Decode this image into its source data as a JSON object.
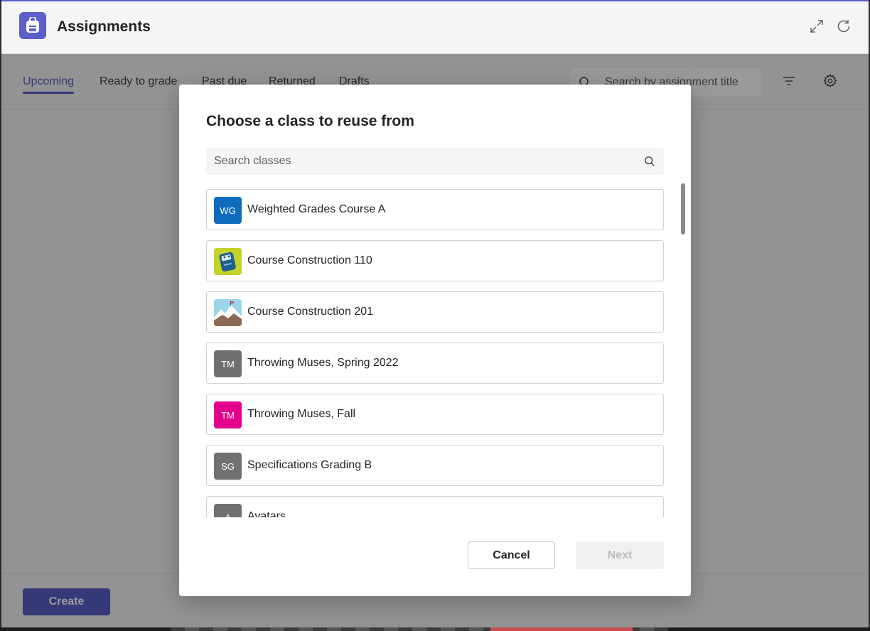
{
  "app": {
    "title": "Assignments"
  },
  "tabs": [
    {
      "label": "Upcoming",
      "active": true
    },
    {
      "label": "Ready to grade",
      "active": false
    },
    {
      "label": "Past due",
      "active": false
    },
    {
      "label": "Returned",
      "active": false
    },
    {
      "label": "Drafts",
      "active": false
    }
  ],
  "search": {
    "placeholder": "Search by assignment title"
  },
  "footer": {
    "create_label": "Create"
  },
  "dialog": {
    "title": "Choose a class to reuse from",
    "search_placeholder": "Search classes",
    "classes": [
      {
        "name": "Weighted Grades Course A",
        "initials": "WG",
        "color": "#0f6cbd",
        "avatar": "initials"
      },
      {
        "name": "Course Construction 110",
        "initials": "",
        "color": "#c4d22a",
        "avatar": "image-robot"
      },
      {
        "name": "Course Construction 201",
        "initials": "",
        "color": "#8fd0e8",
        "avatar": "image-mountain"
      },
      {
        "name": "Throwing Muses, Spring 2022",
        "initials": "TM",
        "color": "#707070",
        "avatar": "initials"
      },
      {
        "name": "Throwing Muses, Fall",
        "initials": "TM",
        "color": "#e3008c",
        "avatar": "initials"
      },
      {
        "name": "Specifications Grading B",
        "initials": "SG",
        "color": "#707070",
        "avatar": "initials"
      },
      {
        "name": "Avatars",
        "initials": "A",
        "color": "#707070",
        "avatar": "initials"
      }
    ],
    "cancel_label": "Cancel",
    "next_label": "Next"
  },
  "colors": {
    "accent": "#5b5fc7",
    "text": "#242424"
  },
  "icons": [
    "backpack-icon",
    "expand-icon",
    "refresh-icon",
    "search-icon",
    "filter-icon",
    "gear-icon"
  ]
}
